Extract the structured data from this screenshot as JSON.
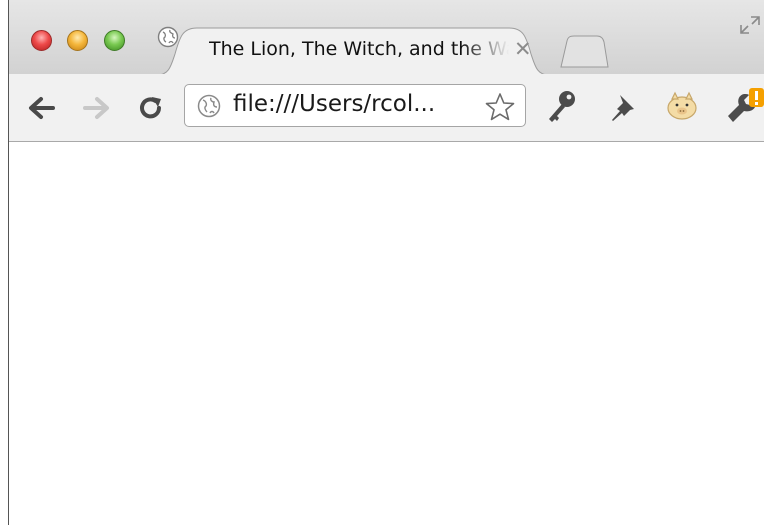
{
  "window": {
    "controls": [
      "close-button",
      "minimize-button",
      "zoom-button"
    ]
  },
  "tabs": [
    {
      "title": "The Lion, The Witch, and the Wardrobe",
      "icon": "globe-icon",
      "active": true
    }
  ],
  "toolbar": {
    "back_icon": "back-arrow-icon",
    "forward_icon": "forward-arrow-icon",
    "reload_icon": "reload-icon",
    "address": "file:///Users/rcol...",
    "bookmark_icon": "star-icon",
    "extensions": [
      "key-icon",
      "pushpin-icon",
      "pig-icon"
    ],
    "menu_icon": "wrench-icon"
  },
  "colors": {
    "badge": "#f5a000",
    "window_border": "#555555"
  }
}
